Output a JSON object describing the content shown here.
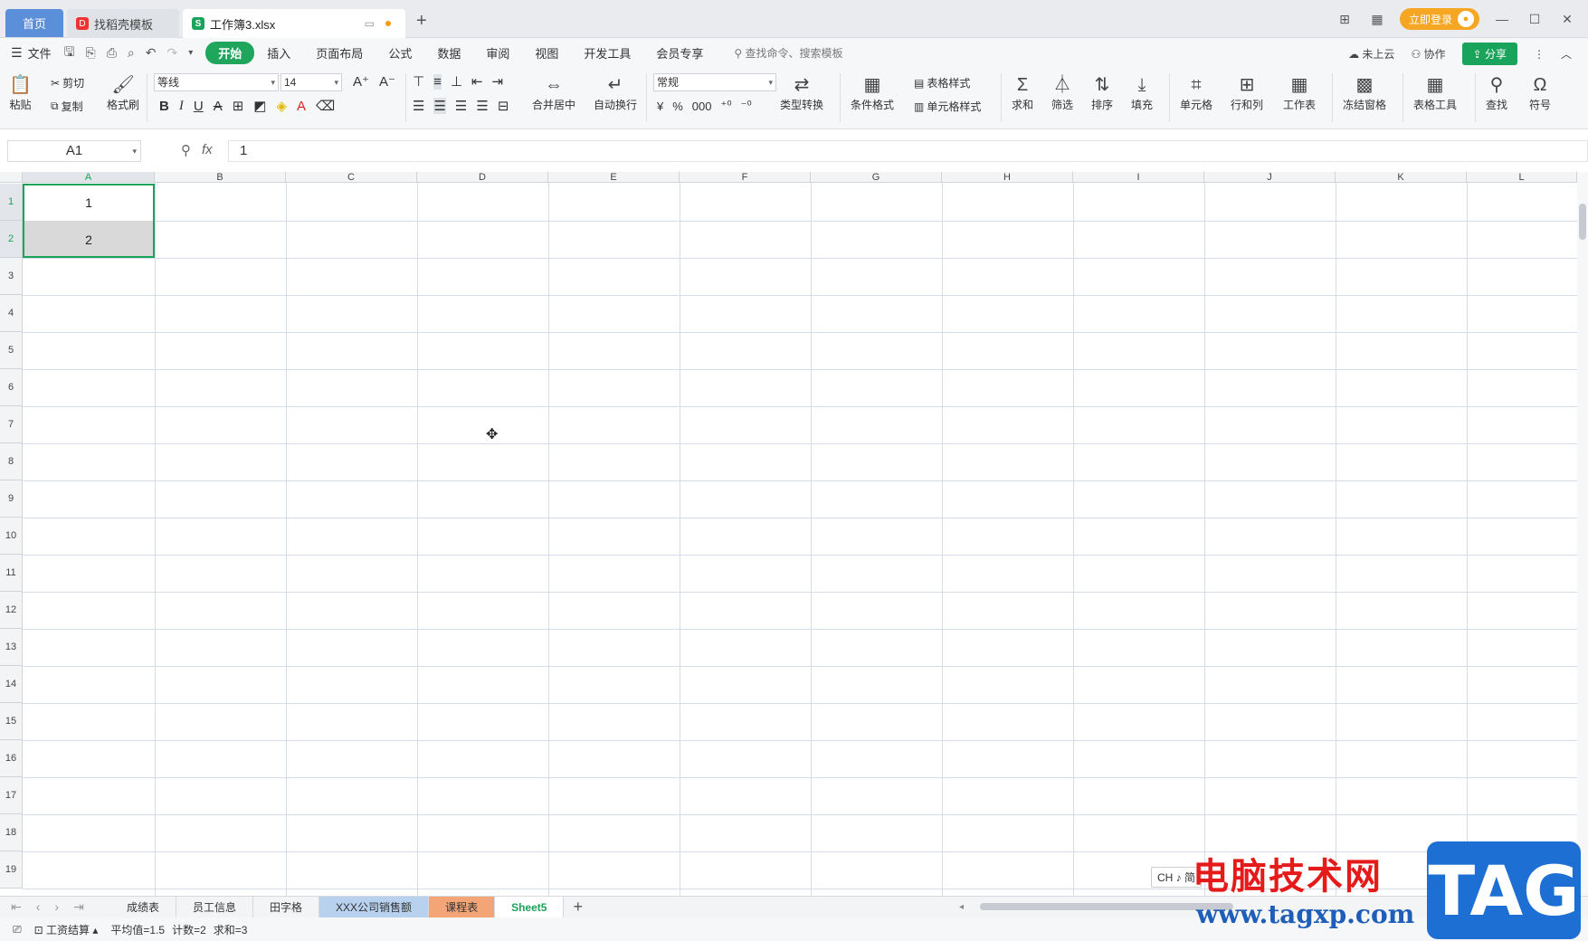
{
  "titlebar": {
    "tabs": [
      {
        "label": "首页"
      },
      {
        "label": "找稻壳模板",
        "icon_text": "D"
      },
      {
        "label": "工作簿3.xlsx",
        "icon_text": "S"
      }
    ],
    "new_tab": "+",
    "login_label": "立即登录"
  },
  "menubar": {
    "file": "文件",
    "tabs": [
      "开始",
      "插入",
      "页面布局",
      "公式",
      "数据",
      "审阅",
      "视图",
      "开发工具",
      "会员专享"
    ],
    "search_placeholder": "查找命令、搜索模板",
    "cloud": "未上云",
    "collab": "协作",
    "share": "分享"
  },
  "ribbon": {
    "paste": "粘贴",
    "cut": "剪切",
    "copy": "复制",
    "format_painter": "格式刷",
    "font_name": "等线",
    "font_size": "14",
    "merge": "合并居中",
    "wrap": "自动换行",
    "number_format": "常规",
    "type_convert": "类型转换",
    "cond_format": "条件格式",
    "table_style": "表格样式",
    "cell_style": "单元格样式",
    "sum": "求和",
    "filter": "筛选",
    "sort": "排序",
    "fill": "填充",
    "cell": "单元格",
    "row_col": "行和列",
    "worksheet": "工作表",
    "freeze": "冻结窗格",
    "table_tools": "表格工具",
    "find": "查找",
    "symbol": "符号"
  },
  "formula_bar": {
    "name_box": "A1",
    "fx": "fx",
    "value": "1"
  },
  "grid": {
    "columns": [
      "A",
      "B",
      "C",
      "D",
      "E",
      "F",
      "G",
      "H",
      "I",
      "J",
      "K",
      "L"
    ],
    "rows": [
      "1",
      "2",
      "3",
      "4",
      "5",
      "6",
      "7",
      "8",
      "9",
      "10",
      "11",
      "12",
      "13",
      "14",
      "15",
      "16",
      "17",
      "18",
      "19"
    ],
    "cells": {
      "A1": "1",
      "A2": "2"
    }
  },
  "sheets": [
    {
      "label": "成绩表"
    },
    {
      "label": "员工信息"
    },
    {
      "label": "田字格"
    },
    {
      "label": "XXX公司销售额"
    },
    {
      "label": "课程表"
    },
    {
      "label": "Sheet5"
    }
  ],
  "statusbar": {
    "mode": "工资结算",
    "average": "平均值=1.5",
    "count": "计数=2",
    "sum": "求和=3"
  },
  "ime": "CH ♪ 简",
  "watermark": {
    "cn": "电脑技术网",
    "url": "www.tagxp.com",
    "tag": "TAG"
  },
  "colors": {
    "accent": "#1aa35a",
    "home_tab": "#5b8fd9",
    "login": "#f5a623"
  }
}
